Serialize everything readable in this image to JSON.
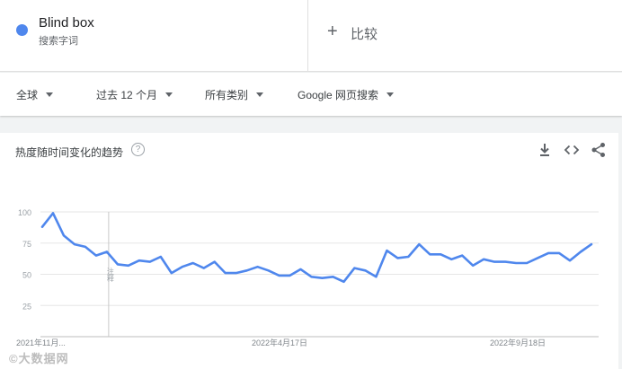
{
  "colors": {
    "accent": "#4f87ed",
    "grid": "#e6e6e6"
  },
  "search_term": {
    "name": "Blind box",
    "type": "搜索字词",
    "dot_color": "#4f87ed"
  },
  "compare": {
    "label": "比较",
    "icon": "plus-icon"
  },
  "filters": [
    {
      "label": "全球"
    },
    {
      "label": "过去 12 个月"
    },
    {
      "label": "所有类别"
    },
    {
      "label": "Google 网页搜索"
    }
  ],
  "card": {
    "title": "热度随时间变化的趋势",
    "help_icon": "?",
    "actions": [
      "download-icon",
      "embed-icon",
      "share-icon"
    ]
  },
  "watermark": "©大数据网",
  "chart_data": {
    "type": "line",
    "title": "",
    "xlabel": "",
    "ylabel": "",
    "ylim": [
      0,
      100
    ],
    "y_ticks": [
      25,
      50,
      75,
      100
    ],
    "x_tick_labels": [
      "2021年11月...",
      "2022年4月17日",
      "2022年9月18日"
    ],
    "annotation": "注释",
    "grid": true,
    "series": [
      {
        "values": [
          88,
          99,
          81,
          74,
          72,
          65,
          68,
          58,
          57,
          61,
          60,
          64,
          51,
          56,
          59,
          55,
          60,
          51,
          51,
          53,
          56,
          53,
          49,
          49,
          54,
          48,
          47,
          48,
          44,
          55,
          53,
          48,
          69,
          63,
          64,
          74,
          66,
          66,
          62,
          65,
          57,
          62,
          60,
          60,
          59,
          59,
          63,
          67,
          67,
          61,
          68,
          74
        ]
      }
    ]
  }
}
